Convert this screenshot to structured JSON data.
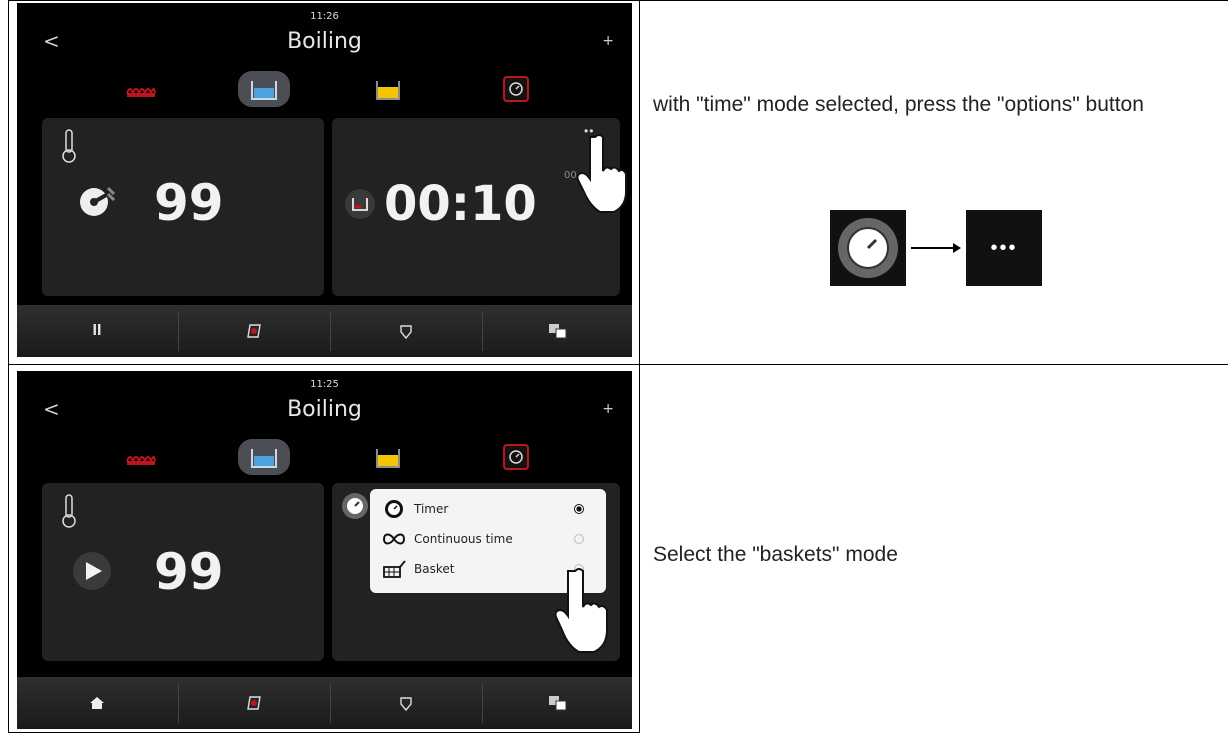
{
  "step1": {
    "clock": "11:26",
    "back_label": "<",
    "title": "Boiling",
    "plus_label": "+",
    "temperature_value": "99",
    "time_value": "00:10",
    "time_seconds": "00",
    "options_label": "•••",
    "bottom_items": [
      {
        "icon": "pause-icon",
        "label": "II"
      },
      {
        "icon": "basket-gauge-icon"
      },
      {
        "icon": "lift-icon"
      },
      {
        "icon": "language-icon"
      }
    ],
    "instruction": "with \"time\" mode selected, press the \"options\" button"
  },
  "step2": {
    "clock": "11:25",
    "back_label": "<",
    "title": "Boiling",
    "plus_label": "+",
    "temperature_value": "99",
    "menu": {
      "items": [
        {
          "label": "Timer",
          "icon": "timer-icon",
          "selected": true
        },
        {
          "label": "Continuous time",
          "icon": "infinity-icon",
          "selected": false
        },
        {
          "label": "Basket",
          "icon": "basket-icon",
          "selected": false
        }
      ]
    },
    "bottom_items": [
      {
        "icon": "home-icon"
      },
      {
        "icon": "basket-gauge-icon"
      },
      {
        "icon": "lift-icon"
      },
      {
        "icon": "language-icon"
      }
    ],
    "instruction": "Select the \"baskets\" mode"
  },
  "colors": {
    "heating_red": "#c0141c",
    "water_blue": "#4aa3df",
    "oil_yellow": "#f5c400",
    "screen_bg": "#000000",
    "panel_bg": "#222222"
  }
}
